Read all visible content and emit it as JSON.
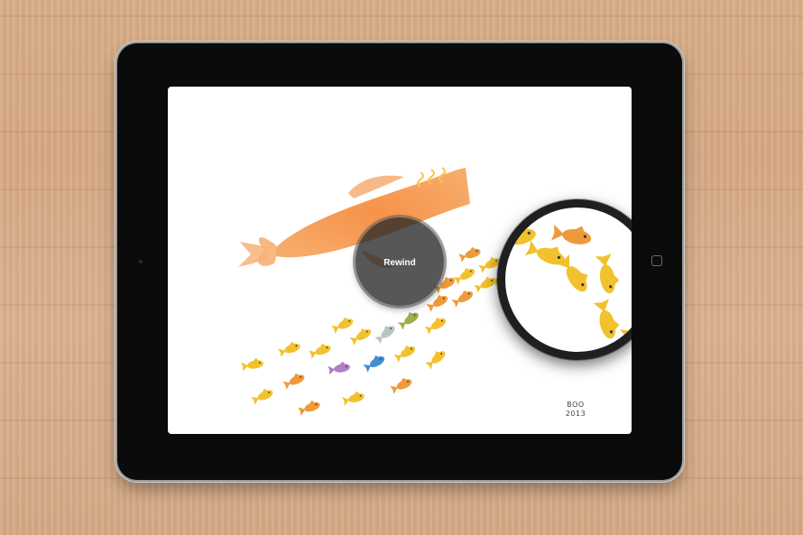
{
  "rewind": {
    "label": "Rewind"
  },
  "signature": {
    "line1": "BOO",
    "line2": "2013"
  },
  "colors": {
    "wood": "#d9ae88",
    "bezel": "#0b0b0b",
    "big_fish": "#f08a3c",
    "school_yellow": "#f2c12e",
    "school_orange": "#ee9a3a",
    "school_purple": "#b07cc6",
    "school_blue": "#3f8fd8",
    "school_green": "#9caf4a",
    "rewind_bg": "#282828"
  },
  "icons": [
    "camera-icon",
    "home-button-icon",
    "fish-icon"
  ]
}
